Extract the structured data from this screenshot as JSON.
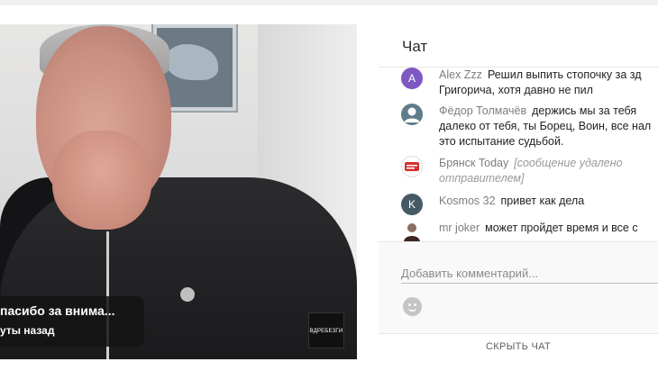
{
  "video": {
    "caption_title": "пасибо за внима...",
    "caption_sub": "уты назад",
    "watermark": "ВДРЕБЕЗГИ"
  },
  "chat": {
    "title": "Чат",
    "messages": [
      {
        "author": "Alex Zzz",
        "avatar_letter": "A",
        "avatar_color": "#7e57c2",
        "lines": [
          "Решил выпить стопочку за зд",
          "Григорича, хотя давно не пил"
        ]
      },
      {
        "author": "Фёдор Толмачёв",
        "avatar_letter": "",
        "avatar_color": "#607d8b",
        "lines": [
          "держись мы за тебя",
          "далеко от тебя, ты Борец, Воин, все нал",
          "это испытание судьбой."
        ]
      },
      {
        "author": "Брянск Today",
        "avatar_letter": "",
        "avatar_color": "#d32f2f",
        "deleted": "[сообщение удалено",
        "deleted2": "отправителем]"
      },
      {
        "author": "Kosmos 32",
        "avatar_letter": "K",
        "avatar_color": "#455a64",
        "lines": [
          "привет как дела"
        ]
      },
      {
        "author": "mr joker",
        "avatar_letter": "",
        "avatar_color": "#5d4037",
        "lines": [
          "может пройдет время и все с"
        ]
      }
    ],
    "input_placeholder": "Добавить комментарий...",
    "hide_label": "СКРЫТЬ ЧАТ",
    "accent": "#2196f3"
  }
}
